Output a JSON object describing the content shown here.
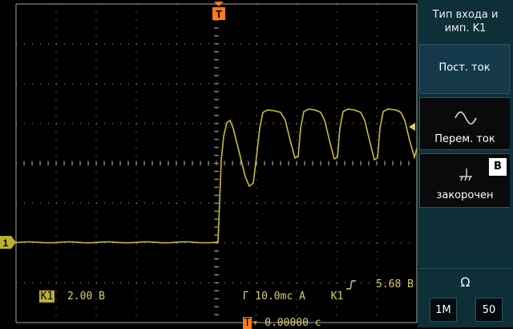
{
  "colors": {
    "trace": "#c9bb3a",
    "grid": "#a9a9a9",
    "trigger": "#ff7a1a",
    "menu_bg": "#0f2f38"
  },
  "markers": {
    "channel_marker": "1",
    "trigger_marker": "T"
  },
  "menu": {
    "title_line1": "Тип входа и",
    "title_line2": "имп. K1",
    "dc_label": "Пост. ток",
    "ac_label": "Перем. ток",
    "ac_icon": "sine-wave-icon",
    "gnd_label": "закорочен",
    "gnd_icon": "ground-icon",
    "badge": "B",
    "impedance_symbol": "Ω",
    "imp_1m": "1M",
    "imp_50": "50"
  },
  "status": {
    "channel_tag": "K1",
    "volts_div": "2.00 В",
    "timebase": "Г 10.0mc",
    "trigger_mode": "A",
    "trigger_source": "K1",
    "trigger_edge_icon": "rising-edge-icon",
    "trigger_level": "5.68 В",
    "trigger_tag": "T",
    "trigger_offset": "0.00000 с"
  }
}
